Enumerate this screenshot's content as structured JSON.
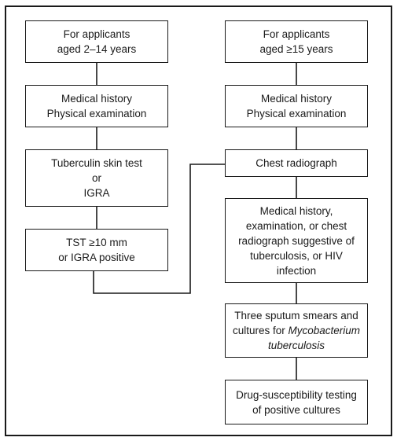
{
  "diagram": {
    "type": "flowchart",
    "left_column": {
      "nodes": [
        {
          "id": "L1",
          "lines": [
            "For applicants",
            "aged 2–14 years"
          ]
        },
        {
          "id": "L2",
          "lines": [
            "Medical history",
            "Physical examination"
          ]
        },
        {
          "id": "L3",
          "lines": [
            "Tuberculin skin test",
            "or",
            "IGRA"
          ]
        },
        {
          "id": "L4",
          "lines": [
            "TST ≥10 mm",
            "or IGRA positive"
          ]
        }
      ]
    },
    "right_column": {
      "nodes": [
        {
          "id": "R1",
          "lines": [
            "For applicants",
            "aged ≥15 years"
          ]
        },
        {
          "id": "R2",
          "lines": [
            "Medical history",
            "Physical examination"
          ]
        },
        {
          "id": "R3",
          "lines": [
            "Chest radiograph"
          ]
        },
        {
          "id": "R4",
          "lines": [
            "Medical history,",
            "examination, or chest",
            "radiograph suggestive of",
            "tuberculosis, or HIV",
            "infection"
          ]
        },
        {
          "id": "R5",
          "lines": [
            "Three sputum smears and",
            "cultures for ",
            "tuberculosis"
          ],
          "italic_term": "Mycobacterium tuberculosis"
        },
        {
          "id": "R6",
          "lines": [
            "Drug-susceptibility testing",
            "of positive cultures"
          ]
        }
      ]
    },
    "r5": {
      "line1": "Three sputum smears and",
      "line2_prefix": "cultures for ",
      "line2_italic": "Mycobacterium",
      "line3_italic": "tuberculosis"
    },
    "edges": [
      [
        "L1",
        "L2"
      ],
      [
        "L2",
        "L3"
      ],
      [
        "L3",
        "L4"
      ],
      [
        "L4",
        "R3"
      ],
      [
        "R1",
        "R2"
      ],
      [
        "R2",
        "R3"
      ],
      [
        "R3",
        "R4"
      ],
      [
        "R4",
        "R5"
      ],
      [
        "R5",
        "R6"
      ]
    ]
  }
}
